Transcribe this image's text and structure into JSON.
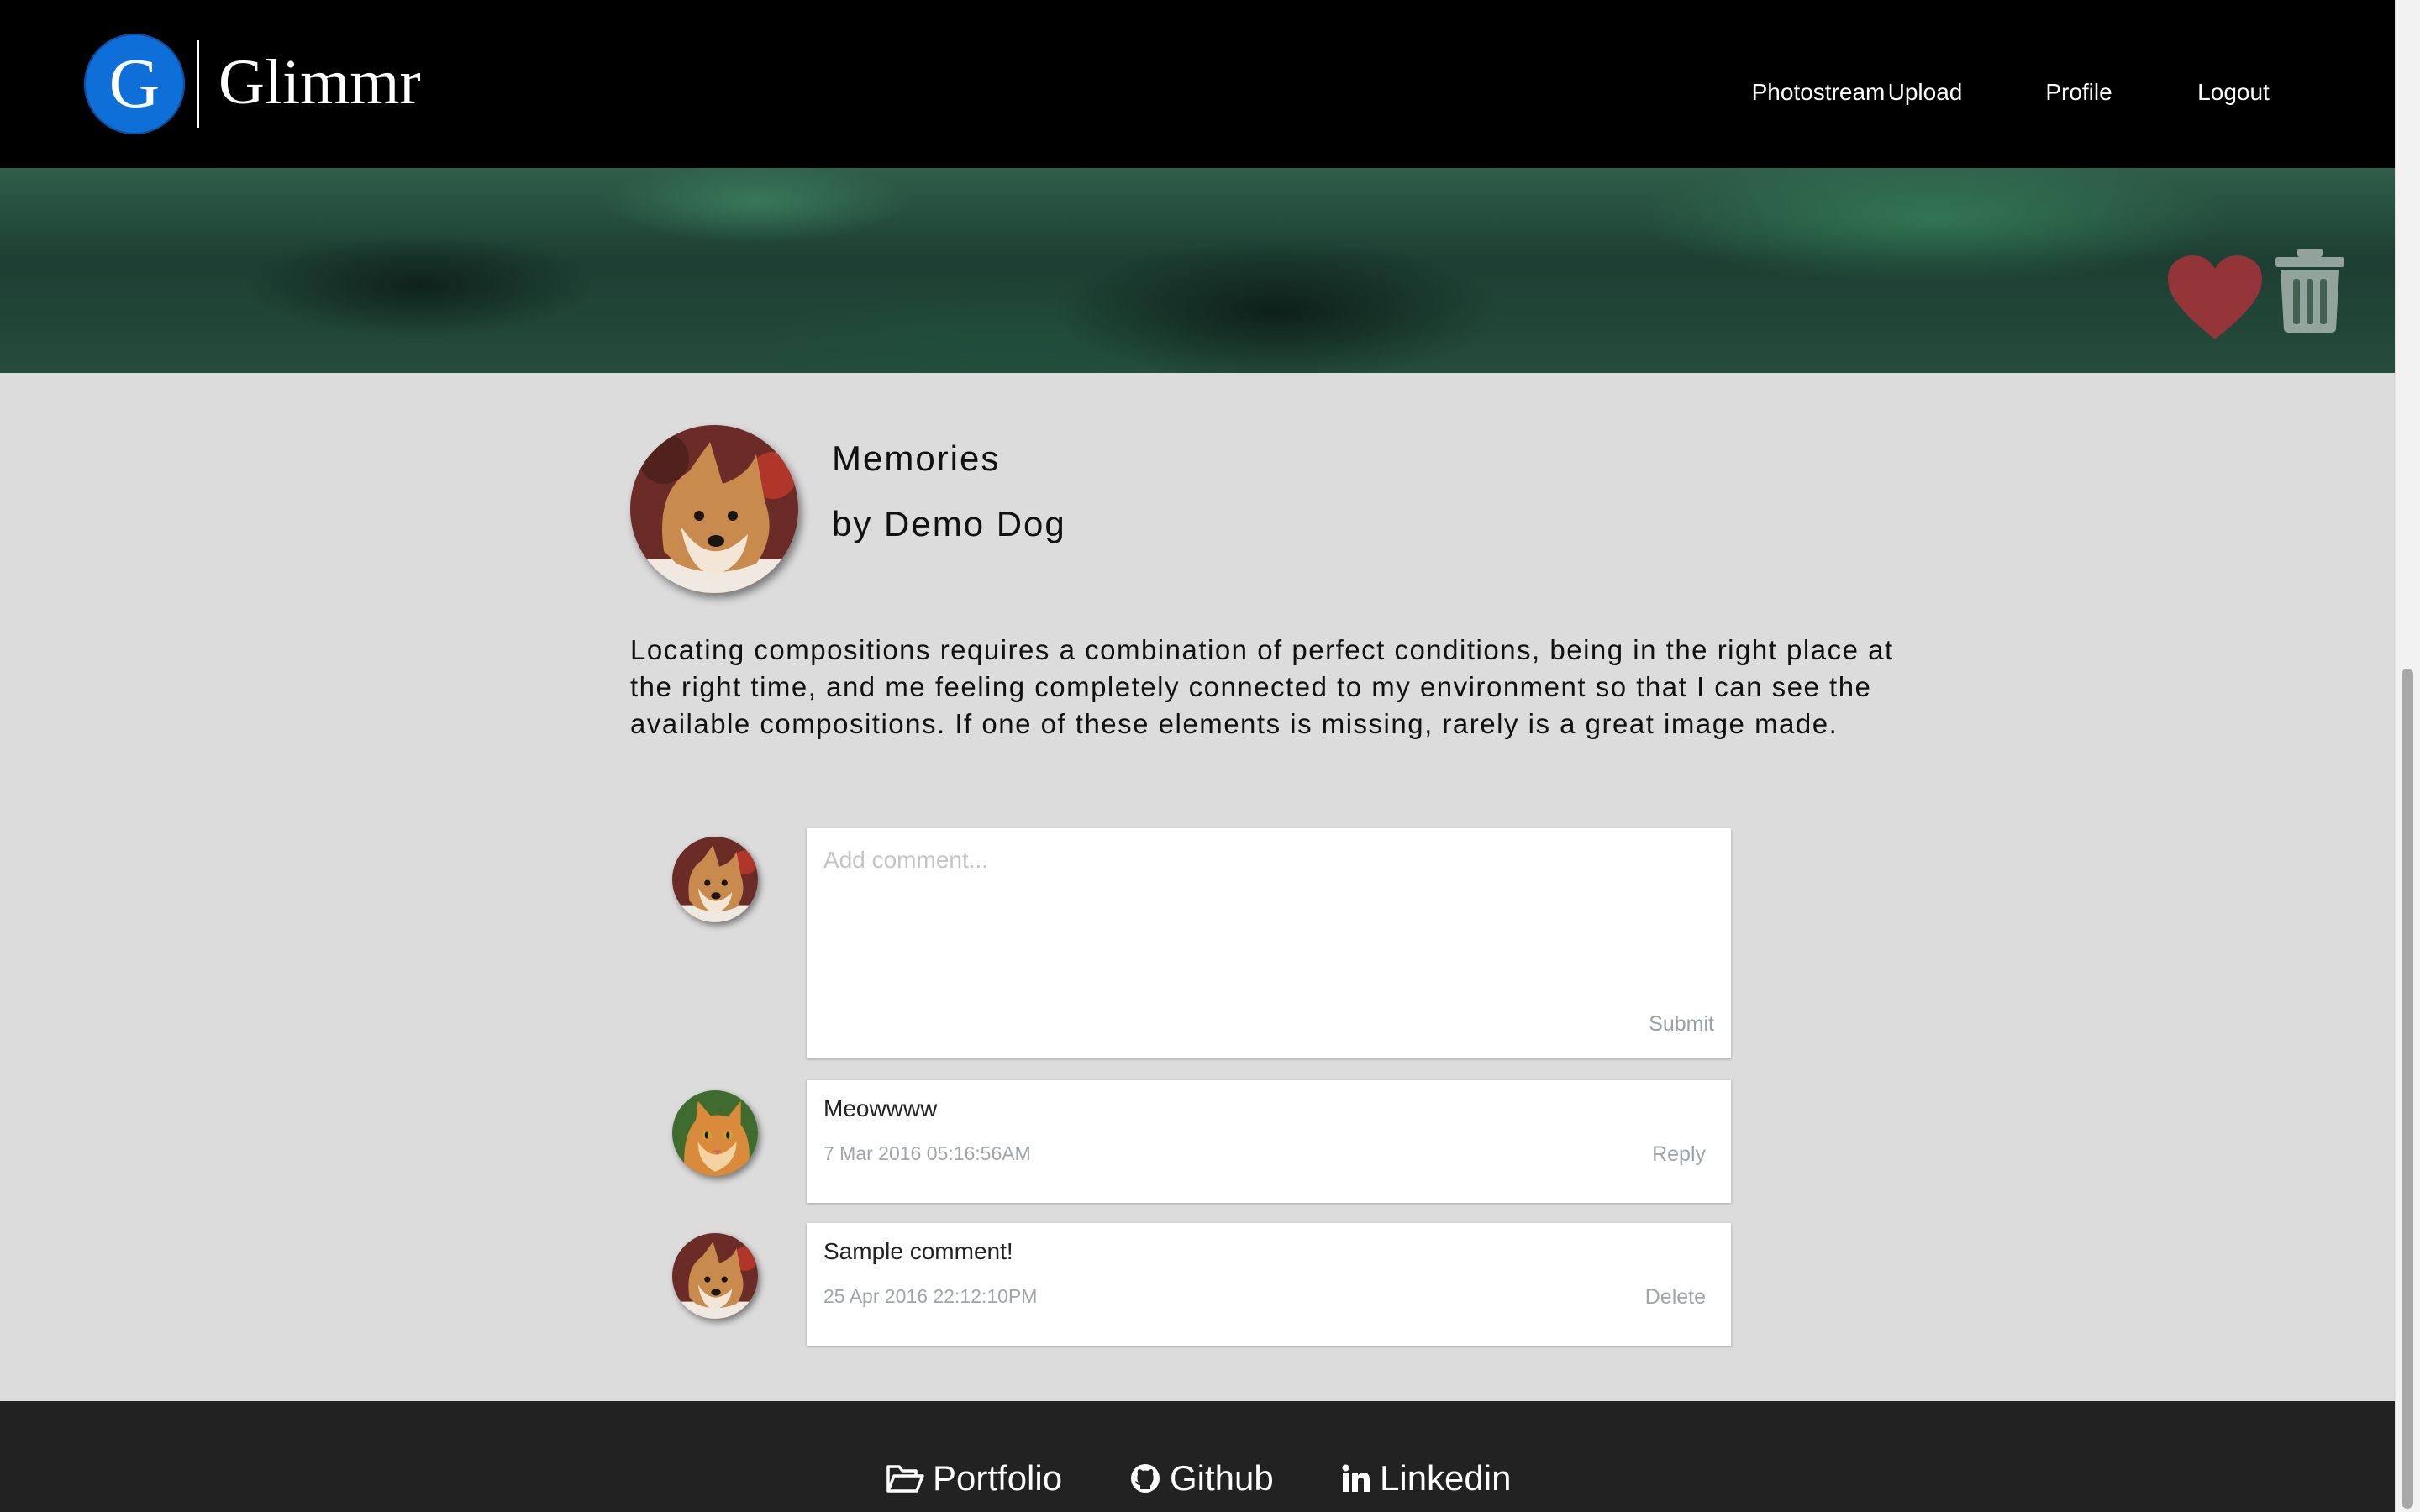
{
  "brand": {
    "logo_letter": "G",
    "name": "Glimmr"
  },
  "nav": {
    "items": [
      {
        "label": "Photostream"
      },
      {
        "label": "Upload"
      },
      {
        "label": "Profile"
      },
      {
        "label": "Logout"
      }
    ]
  },
  "hero": {
    "heart_icon": "heart-icon",
    "trash_icon": "trash-icon"
  },
  "photo": {
    "title": "Memories",
    "author": "by Demo Dog",
    "description": "Locating compositions requires a combination of perfect conditions, being in the right place at the right time, and me feeling completely connected to my environment so that I can see the available compositions. If one of these elements is missing, rarely is a great image made."
  },
  "comment_form": {
    "placeholder": "Add comment...",
    "submit_label": "Submit"
  },
  "comments": [
    {
      "text": "Meowwww",
      "timestamp": "7 Mar 2016 05:16:56AM",
      "action": "Reply"
    },
    {
      "text": "Sample comment!",
      "timestamp": "25 Apr 2016 22:12:10PM",
      "action": "Delete"
    }
  ],
  "footer": {
    "links": [
      {
        "label": "Portfolio",
        "icon": "folder-open-icon"
      },
      {
        "label": "Github",
        "icon": "github-icon"
      },
      {
        "label": "Linkedin",
        "icon": "linkedin-icon"
      }
    ]
  },
  "colors": {
    "brand_blue": "#0f6fd8",
    "header_bg": "#000000",
    "page_bg": "#dcdcdc",
    "footer_bg": "#222222",
    "heart": "#a8323a"
  }
}
